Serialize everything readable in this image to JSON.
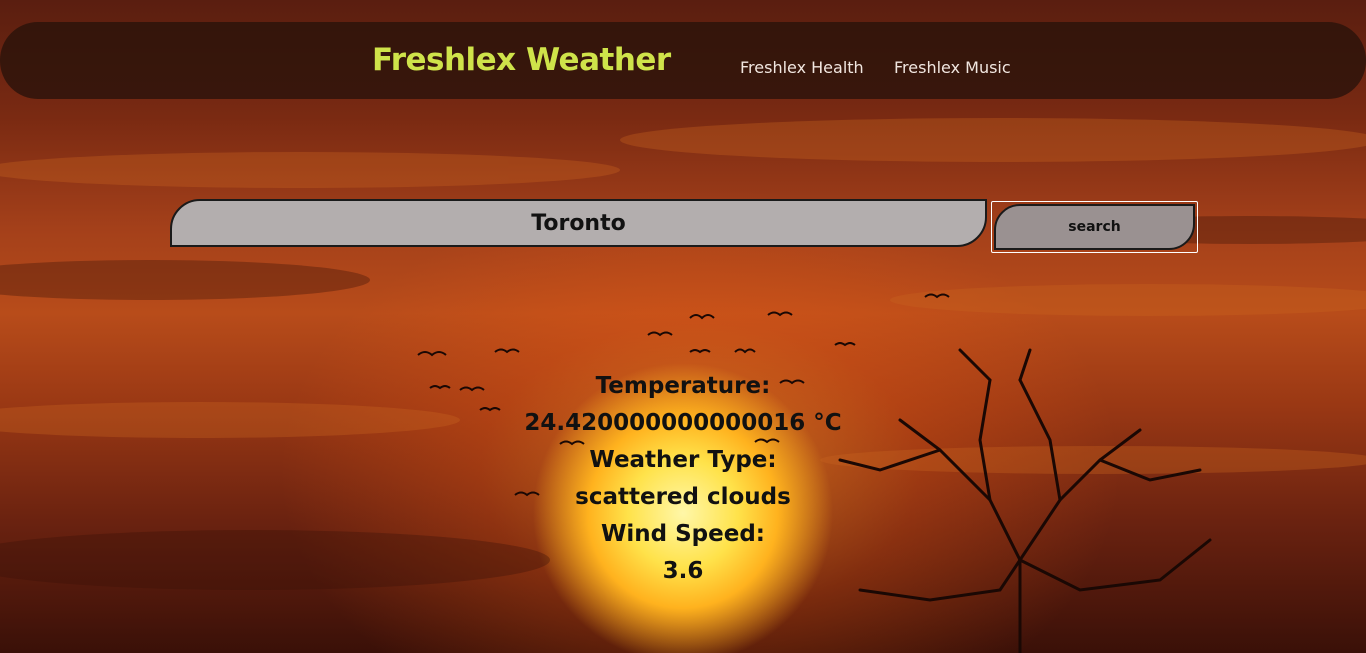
{
  "header": {
    "brand": "Freshlex Weather",
    "nav": [
      {
        "label": "Freshlex Health"
      },
      {
        "label": "Freshlex Music"
      }
    ]
  },
  "search": {
    "value": "Toronto",
    "button_label": "search"
  },
  "weather": {
    "temperature_label": "Temperature:",
    "temperature_value": "24.420000000000016 °C",
    "type_label": "Weather Type:",
    "type_value": "scattered clouds",
    "wind_label": "Wind Speed:",
    "wind_value": "3.6"
  },
  "colors": {
    "brand": "#cfe34a",
    "navbar_bg": "#2a120a",
    "input_bg": "#b3aeae",
    "button_bg": "#9a9191"
  }
}
